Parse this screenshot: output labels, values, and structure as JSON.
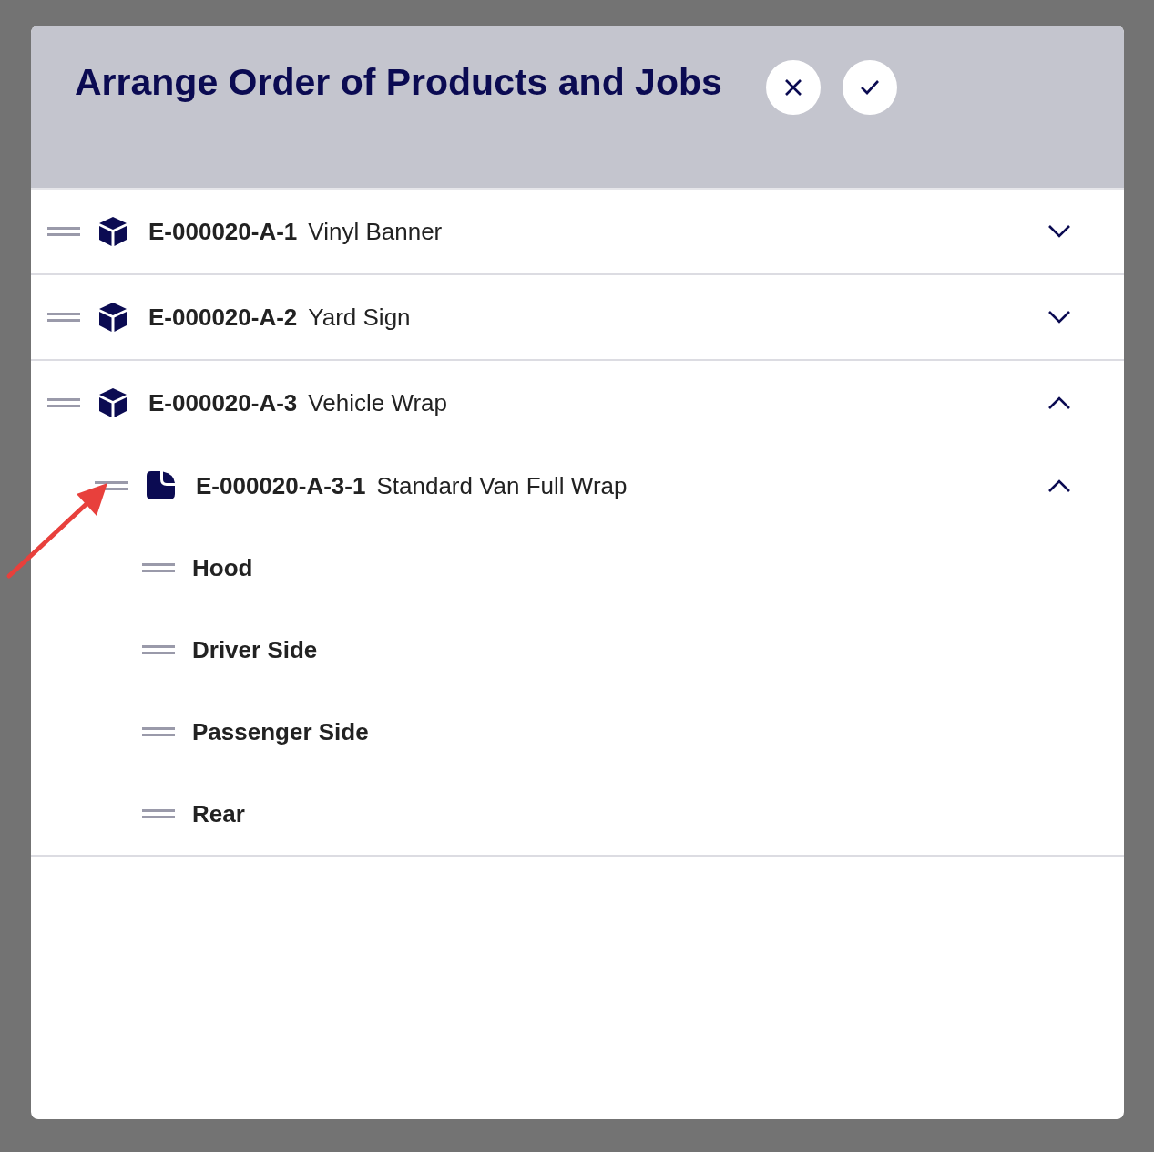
{
  "dialog": {
    "title": "Arrange Order of Products and Jobs",
    "actions": [
      {
        "kind": "cancel"
      },
      {
        "kind": "confirm"
      }
    ]
  },
  "items": [
    {
      "kind": "product",
      "code": "E-000020-A-1",
      "name": "Vinyl Banner",
      "expanded": false
    },
    {
      "kind": "product",
      "code": "E-000020-A-2",
      "name": "Yard Sign",
      "expanded": false
    },
    {
      "kind": "product",
      "code": "E-000020-A-3",
      "name": "Vehicle Wrap",
      "expanded": true,
      "children": [
        {
          "kind": "job",
          "code": "E-000020-A-3-1",
          "name": "Standard Van Full Wrap",
          "expanded": true,
          "children": [
            {
              "kind": "part",
              "name": "Hood"
            },
            {
              "kind": "part",
              "name": "Driver Side"
            },
            {
              "kind": "part",
              "name": "Passenger Side"
            },
            {
              "kind": "part",
              "name": "Rear"
            }
          ]
        }
      ]
    }
  ]
}
